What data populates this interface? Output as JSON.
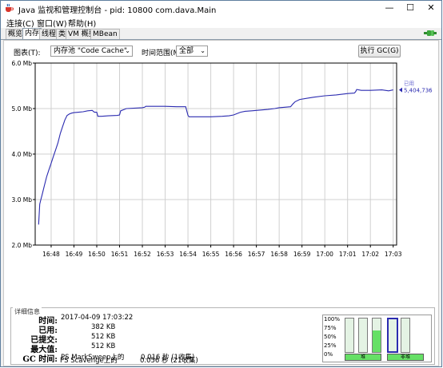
{
  "window": {
    "title": "Java 监视和管理控制台 - pid: 10800 com.dava.Main"
  },
  "window_buttons": {
    "minimize": "—",
    "maximize": "☐",
    "close": "✕"
  },
  "menu": [
    "连接(C)",
    "窗口(W)",
    "帮助(H)"
  ],
  "tabs": [
    {
      "label": "概览",
      "active": false
    },
    {
      "label": "内存",
      "active": true
    },
    {
      "label": "线程",
      "active": false
    },
    {
      "label": "类",
      "active": false
    },
    {
      "label": "VM 概要",
      "active": false
    },
    {
      "label": "MBean",
      "active": false
    }
  ],
  "controls": {
    "chart_label": "图表(T):",
    "chart_value": "内存池 \"Code Cache\"",
    "range_label": "时间范围(M):",
    "range_value": "全部",
    "gc_button": "执行 GC(G)"
  },
  "chart_data": {
    "type": "line",
    "y_tick_labels": [
      "6.0 Mb",
      "5.0 Mb",
      "4.0 Mb",
      "3.0 Mb",
      "2.0 Mb"
    ],
    "y_ticks": [
      6.0,
      5.0,
      4.0,
      3.0,
      2.0
    ],
    "ylim": [
      2.0,
      6.0
    ],
    "x_tick_labels": [
      "16:48",
      "16:49",
      "16:50",
      "16:51",
      "16:52",
      "16:53",
      "16:54",
      "16:55",
      "16:56",
      "16:57",
      "16:58",
      "16:59",
      "17:00",
      "17:01",
      "17:02",
      "17:03"
    ],
    "xlim_minutes": [
      -0.7,
      15.15
    ],
    "grid": true,
    "legend": {
      "position": "right",
      "label": "已用",
      "value": "5,404,736"
    },
    "series": [
      {
        "name": "已用",
        "color": "#2b2bb0",
        "x": [
          -0.55,
          -0.5,
          -0.45,
          -0.4,
          -0.3,
          -0.2,
          -0.1,
          0.0,
          0.1,
          0.2,
          0.3,
          0.4,
          0.5,
          0.6,
          0.7,
          0.8,
          0.9,
          1.0,
          1.2,
          1.4,
          1.6,
          1.8,
          1.9,
          2.0,
          2.05,
          2.2,
          2.5,
          2.9,
          3.0,
          3.05,
          3.3,
          4.0,
          4.1,
          4.15,
          4.5,
          5.0,
          5.5,
          5.9,
          6.0,
          6.05,
          6.5,
          7.0,
          7.5,
          7.8,
          8.0,
          8.2,
          8.3,
          8.5,
          8.8,
          9.0,
          9.5,
          9.8,
          10.0,
          10.5,
          10.6,
          10.7,
          10.9,
          11.5,
          12.0,
          12.5,
          13.0,
          13.3,
          13.35,
          13.4,
          13.6,
          14.0,
          14.5,
          14.8,
          15.0
        ],
        "y": [
          2.45,
          2.9,
          3.0,
          3.1,
          3.3,
          3.5,
          3.65,
          3.8,
          3.95,
          4.1,
          4.25,
          4.45,
          4.6,
          4.75,
          4.85,
          4.88,
          4.9,
          4.91,
          4.92,
          4.93,
          4.95,
          4.96,
          4.92,
          4.92,
          4.83,
          4.83,
          4.84,
          4.85,
          4.86,
          4.95,
          5.0,
          5.02,
          5.03,
          5.05,
          5.05,
          5.05,
          5.04,
          5.04,
          4.85,
          4.82,
          4.82,
          4.82,
          4.83,
          4.84,
          4.86,
          4.9,
          4.92,
          4.94,
          4.95,
          4.96,
          4.98,
          5.0,
          5.02,
          5.04,
          5.1,
          5.15,
          5.2,
          5.25,
          5.28,
          5.3,
          5.33,
          5.34,
          5.37,
          5.42,
          5.4,
          5.4,
          5.41,
          5.39,
          5.41
        ]
      }
    ]
  },
  "details": {
    "title": "详细信息",
    "time_key": "时间:",
    "time_val": "2017-04-09 17:03:22",
    "used_key": "已用:",
    "used_val": "382 KB",
    "committed_key": "已提交:",
    "committed_val": "512 KB",
    "max_key": "最大值:",
    "max_val": "512 KB",
    "gc_key": "GC 时间:",
    "gc1_name": "PS MarkSweep上的",
    "gc1_time": "0.016 秒 (1收集)",
    "gc2_name": "PS Scavenge上的",
    "gc2_time": "0.056 秒 (21收集)"
  },
  "pool_panel": {
    "percent_labels": [
      "100%",
      "75%",
      "50%",
      "25%",
      "0%"
    ],
    "bars": [
      {
        "label": "堆",
        "fill": 0.0
      },
      {
        "label": "",
        "fill": 0.0
      },
      {
        "label": "",
        "fill": 0.65
      },
      {
        "label": "非堆",
        "fill": 0.0
      },
      {
        "label": "",
        "fill": 0.0
      }
    ],
    "heap_label": "堆",
    "nonheap_label": "非堆",
    "colors": {
      "fill": "#66e066",
      "empty": "#e4f3e4",
      "selected_border": "#2b2bb0"
    }
  }
}
